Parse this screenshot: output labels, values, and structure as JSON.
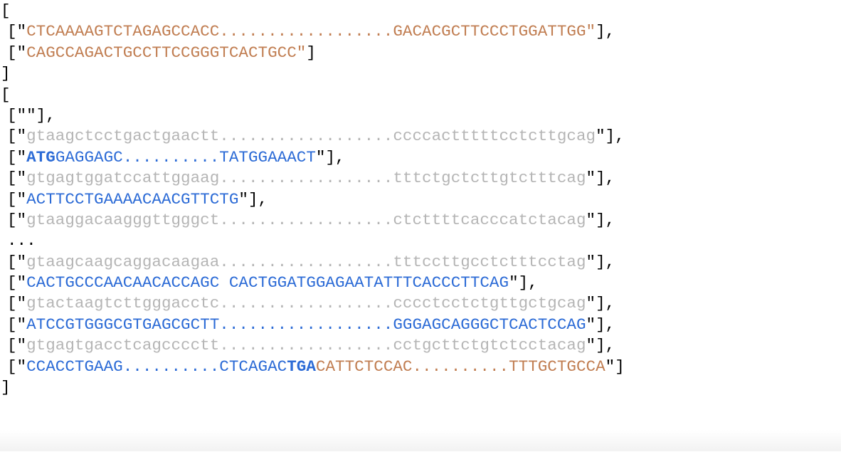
{
  "colors": {
    "punct": "#000000",
    "orange": "#c17e52",
    "grey": "#b5b5b5",
    "blue": "#2c6bd6"
  },
  "lines": [
    {
      "indent": false,
      "segs": [
        {
          "t": "[",
          "c": "punct"
        }
      ]
    },
    {
      "indent": true,
      "segs": [
        {
          "t": "[\"",
          "c": "punct"
        },
        {
          "t": "CTCAAAAGTCTAGAGCCACC..................GACACGCTTCCCTGGATTGG",
          "c": "orange"
        },
        {
          "t": "\"",
          "c": "orange"
        },
        {
          "t": "],",
          "c": "punct"
        }
      ]
    },
    {
      "indent": true,
      "segs": [
        {
          "t": "[\"",
          "c": "punct"
        },
        {
          "t": "CAGCCAGACTGCCTTCCGGGTCACTGCC",
          "c": "orange"
        },
        {
          "t": "\"",
          "c": "orange"
        },
        {
          "t": "]",
          "c": "punct"
        }
      ]
    },
    {
      "indent": false,
      "segs": [
        {
          "t": "]",
          "c": "punct"
        }
      ]
    },
    {
      "indent": false,
      "segs": [
        {
          "t": "[",
          "c": "punct"
        }
      ]
    },
    {
      "indent": true,
      "segs": [
        {
          "t": "[\"\"],",
          "c": "punct"
        }
      ]
    },
    {
      "indent": true,
      "segs": [
        {
          "t": "[\"",
          "c": "punct"
        },
        {
          "t": "gtaagctcctgactgaactt..................ccccactttttcctcttgcag",
          "c": "grey"
        },
        {
          "t": "\"",
          "c": "punct"
        },
        {
          "t": "],",
          "c": "punct"
        }
      ]
    },
    {
      "indent": true,
      "segs": [
        {
          "t": "[\"",
          "c": "punct"
        },
        {
          "t": "ATG",
          "c": "blue",
          "b": true
        },
        {
          "t": "GAGGAGC..........TATGGAAACT",
          "c": "blue"
        },
        {
          "t": "\"",
          "c": "punct"
        },
        {
          "t": "],",
          "c": "punct"
        }
      ]
    },
    {
      "indent": true,
      "segs": [
        {
          "t": "[\"",
          "c": "punct"
        },
        {
          "t": "gtgagtggatccattggaag..................tttctgctcttgtctttcag",
          "c": "grey"
        },
        {
          "t": "\"",
          "c": "punct"
        },
        {
          "t": "],",
          "c": "punct"
        }
      ]
    },
    {
      "indent": true,
      "segs": [
        {
          "t": "[\"",
          "c": "punct"
        },
        {
          "t": "ACTTCCTGAAAACAACGTTCTG",
          "c": "blue"
        },
        {
          "t": "\"",
          "c": "punct"
        },
        {
          "t": "],",
          "c": "punct"
        }
      ]
    },
    {
      "indent": true,
      "segs": [
        {
          "t": "[\"",
          "c": "punct"
        },
        {
          "t": "gtaaggacaagggttgggct..................ctcttttcacccatctacag",
          "c": "grey"
        },
        {
          "t": "\"",
          "c": "punct"
        },
        {
          "t": "],",
          "c": "punct"
        }
      ]
    },
    {
      "indent": true,
      "segs": [
        {
          "t": "...",
          "c": "punct"
        }
      ]
    },
    {
      "indent": true,
      "segs": [
        {
          "t": "[\"",
          "c": "punct"
        },
        {
          "t": "gtaagcaagcaggacaagaa..................tttccttgcctctttcctag",
          "c": "grey"
        },
        {
          "t": "\"",
          "c": "punct"
        },
        {
          "t": "],",
          "c": "punct"
        }
      ]
    },
    {
      "indent": true,
      "segs": [
        {
          "t": "[\"",
          "c": "punct"
        },
        {
          "t": "CACTGCCCAACAACACCAGC CACTGGATGGAGAATATTTCACCCTTCAG",
          "c": "blue"
        },
        {
          "t": "\"",
          "c": "punct"
        },
        {
          "t": "],",
          "c": "punct"
        }
      ]
    },
    {
      "indent": true,
      "segs": [
        {
          "t": "[\"",
          "c": "punct"
        },
        {
          "t": "gtactaagtcttgggacctc..................cccctcctctgttgctgcag",
          "c": "grey"
        },
        {
          "t": "\"",
          "c": "punct"
        },
        {
          "t": "],",
          "c": "punct"
        }
      ]
    },
    {
      "indent": true,
      "segs": [
        {
          "t": "[\"",
          "c": "punct"
        },
        {
          "t": "ATCCGTGGGCGTGAGCGCTT..................GGGAGCAGGGCTCACTCCAG",
          "c": "blue"
        },
        {
          "t": "\"",
          "c": "punct"
        },
        {
          "t": "],",
          "c": "punct"
        }
      ]
    },
    {
      "indent": true,
      "segs": [
        {
          "t": "[\"",
          "c": "punct"
        },
        {
          "t": "gtgagtgacctcagcccctt..................cctgcttctgtctcctacag",
          "c": "grey"
        },
        {
          "t": "\"",
          "c": "punct"
        },
        {
          "t": "],",
          "c": "punct"
        }
      ]
    },
    {
      "indent": true,
      "segs": [
        {
          "t": "[\"",
          "c": "punct"
        },
        {
          "t": "CCACCTGAAG..........CTCAGAC",
          "c": "blue"
        },
        {
          "t": "TGA",
          "c": "blue",
          "b": true
        },
        {
          "t": "CATTCTCCAC..........TTTGCTGCCA",
          "c": "orange"
        },
        {
          "t": "\"",
          "c": "punct"
        },
        {
          "t": "]",
          "c": "punct"
        }
      ]
    },
    {
      "indent": false,
      "segs": [
        {
          "t": "]",
          "c": "punct"
        }
      ]
    }
  ]
}
